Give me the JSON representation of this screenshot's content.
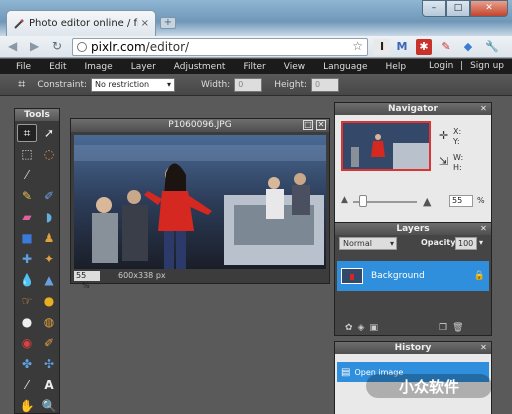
{
  "browser": {
    "tab_title": "Photo editor online / fr...",
    "tab_close": "×",
    "new_tab": "+",
    "url_host": "pixlr.com",
    "url_path": "/editor/",
    "window_buttons": [
      "–",
      "□",
      "✕"
    ]
  },
  "menu": {
    "items": [
      "File",
      "Edit",
      "Image",
      "Layer",
      "Adjustment",
      "Filter",
      "View",
      "Language",
      "Help"
    ],
    "login": "Login",
    "separator": "|",
    "signup": "Sign up"
  },
  "options": {
    "constraint_label": "Constraint:",
    "constraint_value": "No restriction",
    "width_label": "Width:",
    "width_value": "0",
    "height_label": "Height:",
    "height_value": "0"
  },
  "tools": {
    "title": "Tools"
  },
  "document": {
    "title": "P1060096.JPG",
    "zoom": "55",
    "zoom_unit": "%",
    "dimensions": "600x338 px"
  },
  "navigator": {
    "title": "Navigator",
    "x_label": "X:",
    "y_label": "Y:",
    "w_label": "W:",
    "h_label": "H:",
    "zoom": "55",
    "zoom_unit": "%",
    "zoom_fraction": 0.15
  },
  "layers": {
    "title": "Layers",
    "blend_mode": "Normal",
    "opacity_label": "Opacity:",
    "opacity_value": "100",
    "items": [
      {
        "name": "Background"
      }
    ]
  },
  "history": {
    "title": "History",
    "items": [
      "Open image"
    ]
  },
  "watermark": "小众软件",
  "colors": {
    "accent_blue": "#2f8fdc",
    "app_bg": "#5a5a5a",
    "menubar": "#1b1b1b"
  }
}
